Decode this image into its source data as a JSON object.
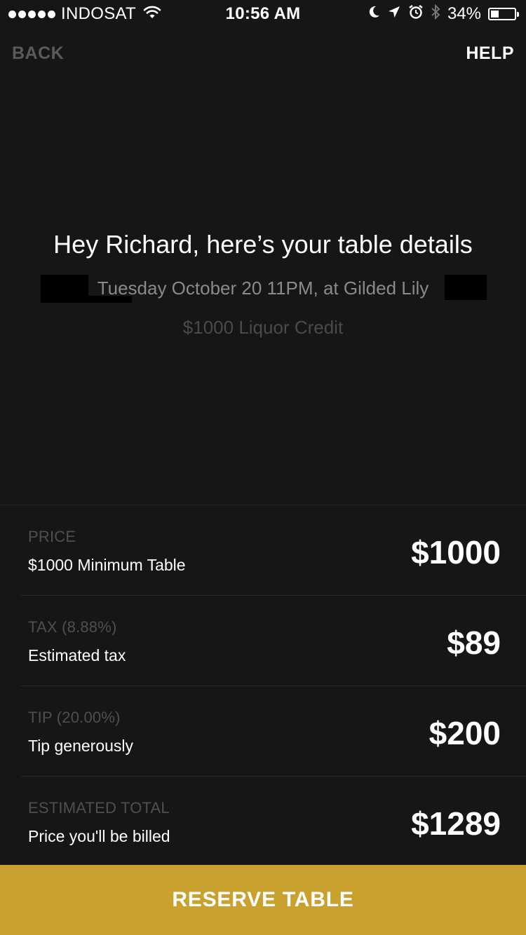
{
  "status_bar": {
    "carrier": "INDOSAT",
    "time": "10:56 AM",
    "battery": "34%",
    "battery_level": 0.34
  },
  "nav": {
    "back_label": "BACK",
    "help_label": "HELP"
  },
  "hero": {
    "headline": "Hey Richard, here’s your table details",
    "details": "Tuesday October 20 11PM, at Gilded Lily",
    "credit": "$1000 Liquor Credit"
  },
  "breakdown": [
    {
      "label": "PRICE",
      "sub": "$1000 Minimum Table",
      "amount": "$1000"
    },
    {
      "label": "TAX (8.88%)",
      "sub": "Estimated tax",
      "amount": "$89"
    },
    {
      "label": "TIP (20.00%)",
      "sub": "Tip generously",
      "amount": "$200"
    },
    {
      "label": "ESTIMATED TOTAL",
      "sub": "Price you'll be billed",
      "amount": "$1289"
    }
  ],
  "cta": {
    "label": "RESERVE TABLE"
  },
  "icons": {
    "wifi": "wifi-icon",
    "moon": "moon-icon",
    "location": "location-arrow-icon",
    "alarm": "alarm-icon",
    "bluetooth": "bluetooth-icon",
    "battery": "battery-icon"
  },
  "colors": {
    "background": "#161616",
    "accent": "#c9a12e",
    "muted": "#4f4f4f"
  }
}
